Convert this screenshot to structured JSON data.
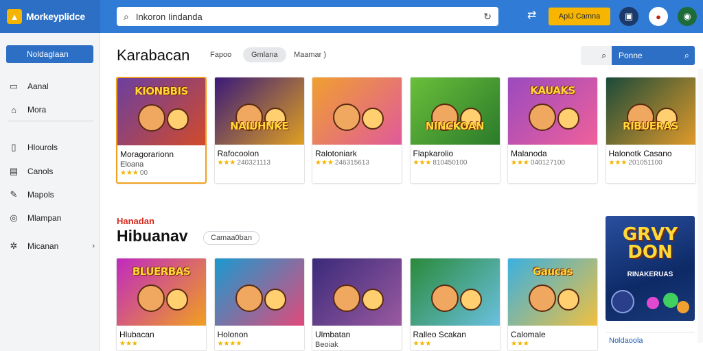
{
  "app": {
    "name": "Morkeyplidce"
  },
  "search": {
    "placeholder": "Inkoron Iindanda"
  },
  "topbar": {
    "apply_label": "ApIJ Camna"
  },
  "sidebar": {
    "primary_label": "Noldaglaan",
    "items": [
      {
        "label": "Aanal",
        "icon": "grid-icon"
      },
      {
        "label": "Mora",
        "icon": "home-icon"
      },
      {
        "label": "Hlourols",
        "icon": "archive-icon"
      },
      {
        "label": "Canols",
        "icon": "document-icon"
      },
      {
        "label": "Mapols",
        "icon": "pencil-icon"
      },
      {
        "label": "Mlampan",
        "icon": "circle-icon"
      },
      {
        "label": "Micanan",
        "icon": "gear-icon"
      }
    ]
  },
  "section1": {
    "title": "Karabacan",
    "filters": [
      "Fapoo",
      "Gmlana",
      "Maamar )"
    ],
    "sort_label": "Ponne"
  },
  "row1": [
    {
      "name": "Moragorarionn",
      "sub": "Eloana",
      "stars": "★★★",
      "meta": "00",
      "thumb_title": "KIONBBIS",
      "c1": "#6b3fa0",
      "c2": "#d24a2a"
    },
    {
      "name": "Rafocoolon",
      "sub": "",
      "stars": "★★★",
      "meta": "240321113",
      "thumb_title": "NAIUHNKE",
      "c1": "#3a1a7a",
      "c2": "#e0a020"
    },
    {
      "name": "Ralotoniark",
      "sub": "",
      "stars": "★★★",
      "meta": "246315613",
      "thumb_title": "",
      "c1": "#f0a030",
      "c2": "#e05a9a"
    },
    {
      "name": "Flapkarolio",
      "sub": "",
      "stars": "★★★",
      "meta": "810450100",
      "thumb_title": "NINCKOAN",
      "c1": "#6abf3a",
      "c2": "#2a7a2a"
    },
    {
      "name": "Malanoda",
      "sub": "",
      "stars": "★★★",
      "meta": "040127100",
      "thumb_title": "KAUAKS",
      "c1": "#9a4ac0",
      "c2": "#f0609a"
    },
    {
      "name": "Halonotk Casano",
      "sub": "",
      "stars": "★★★",
      "meta": "201051100",
      "thumb_title": "RIBUERAS",
      "c1": "#1a4a3a",
      "c2": "#e09a2a"
    }
  ],
  "section2": {
    "eyebrow": "Hanadan",
    "title": "Hibuanav",
    "chip": "Camaa0ban"
  },
  "row2": [
    {
      "name": "Hlubacan",
      "stars": "★★★",
      "meta": "",
      "thumb_title": "BLUERBAS",
      "c1": "#c02ac0",
      "c2": "#f0a020"
    },
    {
      "name": "Holonon",
      "stars": "★★★★",
      "meta": "",
      "thumb_title": "",
      "c1": "#1a9ad0",
      "c2": "#e04a7a"
    },
    {
      "name": "Ulmbatan",
      "sub": "Beoiak",
      "stars": "",
      "meta": "",
      "thumb_title": "",
      "c1": "#3a2a7a",
      "c2": "#9a5aa0"
    },
    {
      "name": "Ralleo Scakan",
      "stars": "★★★",
      "meta": "",
      "thumb_title": "",
      "c1": "#2a8a3a",
      "c2": "#6ac0e0"
    },
    {
      "name": "Calomale",
      "stars": "★★★",
      "meta": "",
      "thumb_title": "Gaucas",
      "c1": "#3ab0e0",
      "c2": "#f0c040"
    }
  ],
  "promo": {
    "title_line1": "GRVY",
    "title_line2": "DON",
    "subtitle": "RINAKERUAS",
    "caption": "Noldaoola"
  }
}
